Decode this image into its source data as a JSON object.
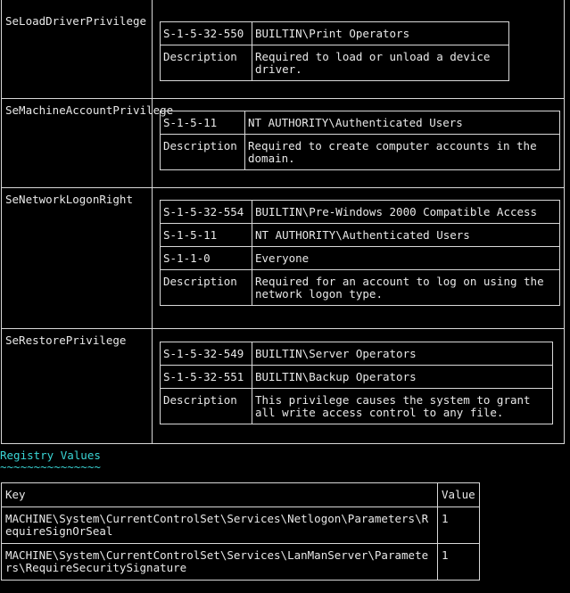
{
  "privileges": [
    {
      "name": "SeLoadDriverPrivilege",
      "entries": [
        {
          "sid": "S-1-5-32-550",
          "account": "BUILTIN\\Print Operators"
        }
      ],
      "description_label": "Description",
      "description": "Required to load or unload a device driver."
    },
    {
      "name": "SeMachineAccountPrivilege",
      "entries": [
        {
          "sid": "S-1-5-11",
          "account": "NT AUTHORITY\\Authenticated Users"
        }
      ],
      "description_label": "Description",
      "description": "Required to create computer accounts in the domain."
    },
    {
      "name": "SeNetworkLogonRight",
      "entries": [
        {
          "sid": "S-1-5-32-554",
          "account": "BUILTIN\\Pre-Windows 2000 Compatible Access"
        },
        {
          "sid": "S-1-5-11",
          "account": "NT AUTHORITY\\Authenticated Users"
        },
        {
          "sid": "S-1-1-0",
          "account": "Everyone"
        }
      ],
      "description_label": "Description",
      "description": "Required for an account to log on using the network logon type."
    },
    {
      "name": "SeRestorePrivilege",
      "entries": [
        {
          "sid": "S-1-5-32-549",
          "account": "BUILTIN\\Server Operators"
        },
        {
          "sid": "S-1-5-32-551",
          "account": "BUILTIN\\Backup Operators"
        }
      ],
      "description_label": "Description",
      "description": "This privilege causes the system to grant all write access control to any file."
    }
  ],
  "registry": {
    "heading": "Registry Values",
    "underline": "~~~~~~~~~~~~~~~",
    "columns": [
      "Key",
      "Value"
    ],
    "rows": [
      {
        "key": "MACHINE\\System\\CurrentControlSet\\Services\\Netlogon\\Parameters\\RequireSignOrSeal",
        "value": "1"
      },
      {
        "key": "MACHINE\\System\\CurrentControlSet\\Services\\LanManServer\\Parameters\\RequireSecuritySignature",
        "value": "1"
      }
    ]
  }
}
